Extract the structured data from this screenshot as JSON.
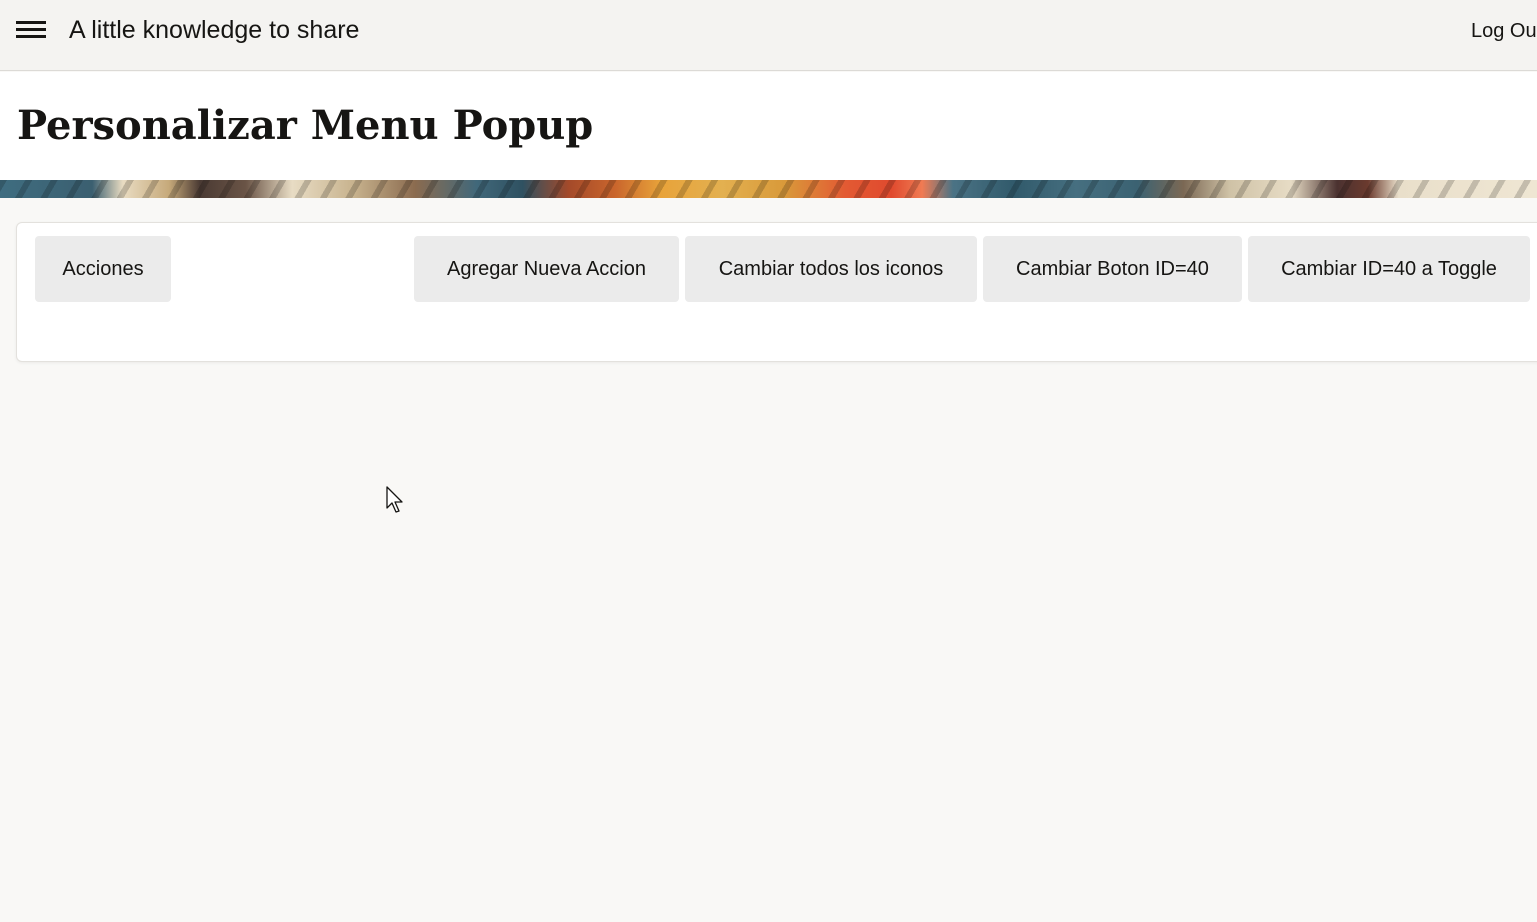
{
  "header": {
    "menu_icon": "hamburger-menu-icon",
    "app_title": "A little knowledge to share",
    "logout_label": "Log Ou"
  },
  "page": {
    "title": "Personalizar Menu Popup"
  },
  "toolbar": {
    "acciones_label": "Acciones",
    "agregar_label": "Agregar Nueva Accion",
    "cambiar_iconos_label": "Cambiar todos los iconos",
    "cambiar_boton_label": "Cambiar Boton ID=40",
    "toggle_label": "Cambiar ID=40 a Toggle"
  },
  "colors": {
    "header_bg": "#f4f3f1",
    "page_bg": "#f9f8f6",
    "button_bg": "#ebebeb",
    "text": "#161513"
  }
}
